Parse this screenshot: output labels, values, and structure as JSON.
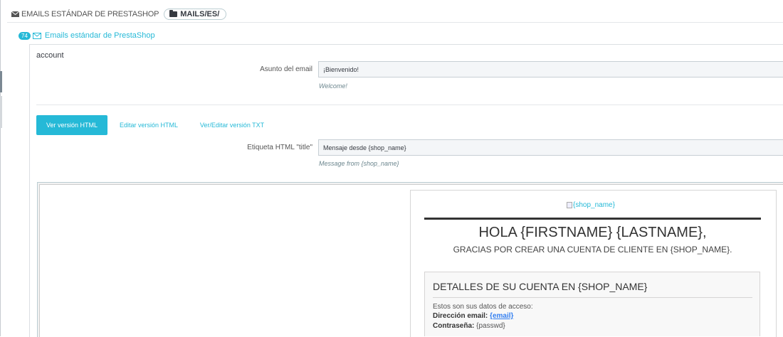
{
  "breadcrumb": {
    "section": "EMAILS ESTÁNDAR DE PRESTASHOP",
    "path": "MAILS/ES/"
  },
  "panel": {
    "count": "74",
    "title": "Emails estándar de PrestaShop"
  },
  "template": {
    "name": "account",
    "subject_label": "Asunto del email",
    "subject_value": "¡Bienvenido!",
    "subject_help": "Welcome!",
    "title_label": "Etiqueta HTML \"title\"",
    "title_value": "Mensaje desde {shop_name}",
    "title_help": "Message from {shop_name}"
  },
  "tabs": [
    {
      "label": "Ver versión HTML",
      "active": true
    },
    {
      "label": "Editar versión HTML",
      "active": false
    },
    {
      "label": "Ver/Editar versión TXT",
      "active": false
    }
  ],
  "preview": {
    "logo_alt": "{shop_name}",
    "heading": "HOLA {FIRSTNAME} {LASTNAME},",
    "subheading": "GRACIAS POR CREAR UNA CUENTA DE CLIENTE EN {SHOP_NAME}.",
    "details_title": "DETALLES DE SU CUENTA EN {SHOP_NAME}",
    "intro": "Estos son sus datos de acceso:",
    "email_label": "Dirección email:",
    "email_value": "{email}",
    "password_label": "Contraseña:",
    "password_value": "{passwd}"
  },
  "colors": {
    "accent": "#25b9d7",
    "text": "#363a41",
    "link": "#337ff1"
  }
}
